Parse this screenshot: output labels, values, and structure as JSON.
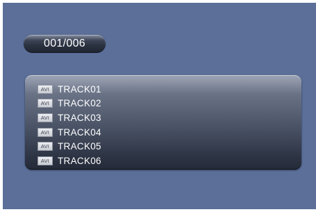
{
  "header": {
    "counter": "001/006"
  },
  "file_list": {
    "items": [
      {
        "type_icon": "AVI",
        "label": "TRACK01"
      },
      {
        "type_icon": "AVI",
        "label": "TRACK02"
      },
      {
        "type_icon": "AVI",
        "label": "TRACK03"
      },
      {
        "type_icon": "AVI",
        "label": "TRACK04"
      },
      {
        "type_icon": "AVI",
        "label": "TRACK05"
      },
      {
        "type_icon": "AVI",
        "label": "TRACK06"
      }
    ]
  },
  "colors": {
    "background": "#5b6f99",
    "text": "#ffffff"
  }
}
